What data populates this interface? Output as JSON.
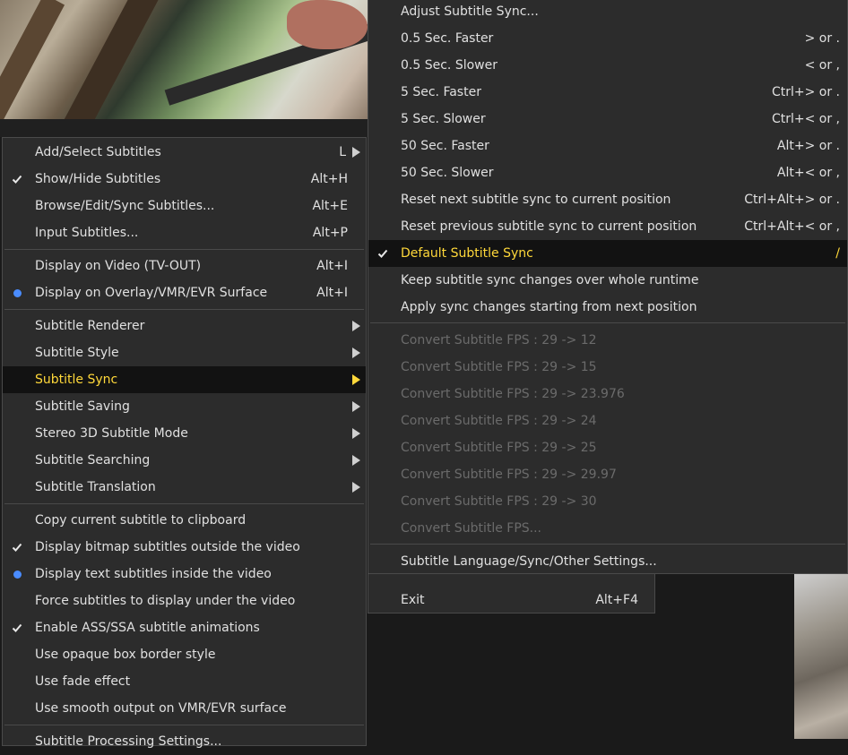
{
  "left_menu": {
    "items": [
      {
        "label": "Add/Select Subtitles",
        "shortcut": "L"
      },
      {
        "label": "Show/Hide Subtitles",
        "shortcut": "Alt+H"
      },
      {
        "label": "Browse/Edit/Sync Subtitles...",
        "shortcut": "Alt+E"
      },
      {
        "label": "Input Subtitles...",
        "shortcut": "Alt+P"
      },
      {
        "label": "Display on Video (TV-OUT)",
        "shortcut": "Alt+I"
      },
      {
        "label": "Display on Overlay/VMR/EVR Surface",
        "shortcut": "Alt+I"
      },
      {
        "label": "Subtitle Renderer"
      },
      {
        "label": "Subtitle Style"
      },
      {
        "label": "Subtitle Sync"
      },
      {
        "label": "Subtitle Saving"
      },
      {
        "label": "Stereo 3D Subtitle Mode"
      },
      {
        "label": "Subtitle Searching"
      },
      {
        "label": "Subtitle Translation"
      },
      {
        "label": "Copy current subtitle to clipboard"
      },
      {
        "label": "Display bitmap subtitles outside the video"
      },
      {
        "label": "Display text subtitles inside the video"
      },
      {
        "label": "Force subtitles to display under the video"
      },
      {
        "label": "Enable ASS/SSA subtitle animations"
      },
      {
        "label": "Use opaque box border style"
      },
      {
        "label": "Use fade effect"
      },
      {
        "label": "Use smooth output on VMR/EVR surface"
      },
      {
        "label": "Subtitle Processing Settings..."
      }
    ]
  },
  "right_menu": {
    "items": [
      {
        "label": "Adjust Subtitle Sync...",
        "shortcut": ""
      },
      {
        "label": "0.5 Sec. Faster",
        "shortcut": "> or ."
      },
      {
        "label": "0.5 Sec. Slower",
        "shortcut": "< or ,"
      },
      {
        "label": "5 Sec. Faster",
        "shortcut": "Ctrl+> or ."
      },
      {
        "label": "5 Sec. Slower",
        "shortcut": "Ctrl+< or ,"
      },
      {
        "label": "50 Sec. Faster",
        "shortcut": "Alt+> or ."
      },
      {
        "label": "50 Sec. Slower",
        "shortcut": "Alt+< or ,"
      },
      {
        "label": "Reset next subtitle sync to current position",
        "shortcut": "Ctrl+Alt+> or ."
      },
      {
        "label": "Reset previous subtitle sync to current position",
        "shortcut": "Ctrl+Alt+< or ,"
      },
      {
        "label": "Default Subtitle Sync",
        "shortcut": "/"
      },
      {
        "label": "Keep subtitle sync changes over whole runtime",
        "shortcut": ""
      },
      {
        "label": "Apply sync changes starting from next position",
        "shortcut": ""
      },
      {
        "label": "Convert Subtitle FPS : 29 -> 12"
      },
      {
        "label": "Convert Subtitle FPS : 29 -> 15"
      },
      {
        "label": "Convert Subtitle FPS : 29 -> 23.976"
      },
      {
        "label": "Convert Subtitle FPS : 29 -> 24"
      },
      {
        "label": "Convert Subtitle FPS : 29 -> 25"
      },
      {
        "label": "Convert Subtitle FPS : 29 -> 29.97"
      },
      {
        "label": "Convert Subtitle FPS : 29 -> 30"
      },
      {
        "label": "Convert Subtitle FPS..."
      },
      {
        "label": "Subtitle Language/Sync/Other Settings..."
      }
    ]
  },
  "exit_menu": {
    "label": "Exit",
    "shortcut": "Alt+F4"
  },
  "colors": {
    "highlight_text": "#ffd83a",
    "radio": "#4a8cff",
    "menu_bg": "#2c2c2c"
  }
}
